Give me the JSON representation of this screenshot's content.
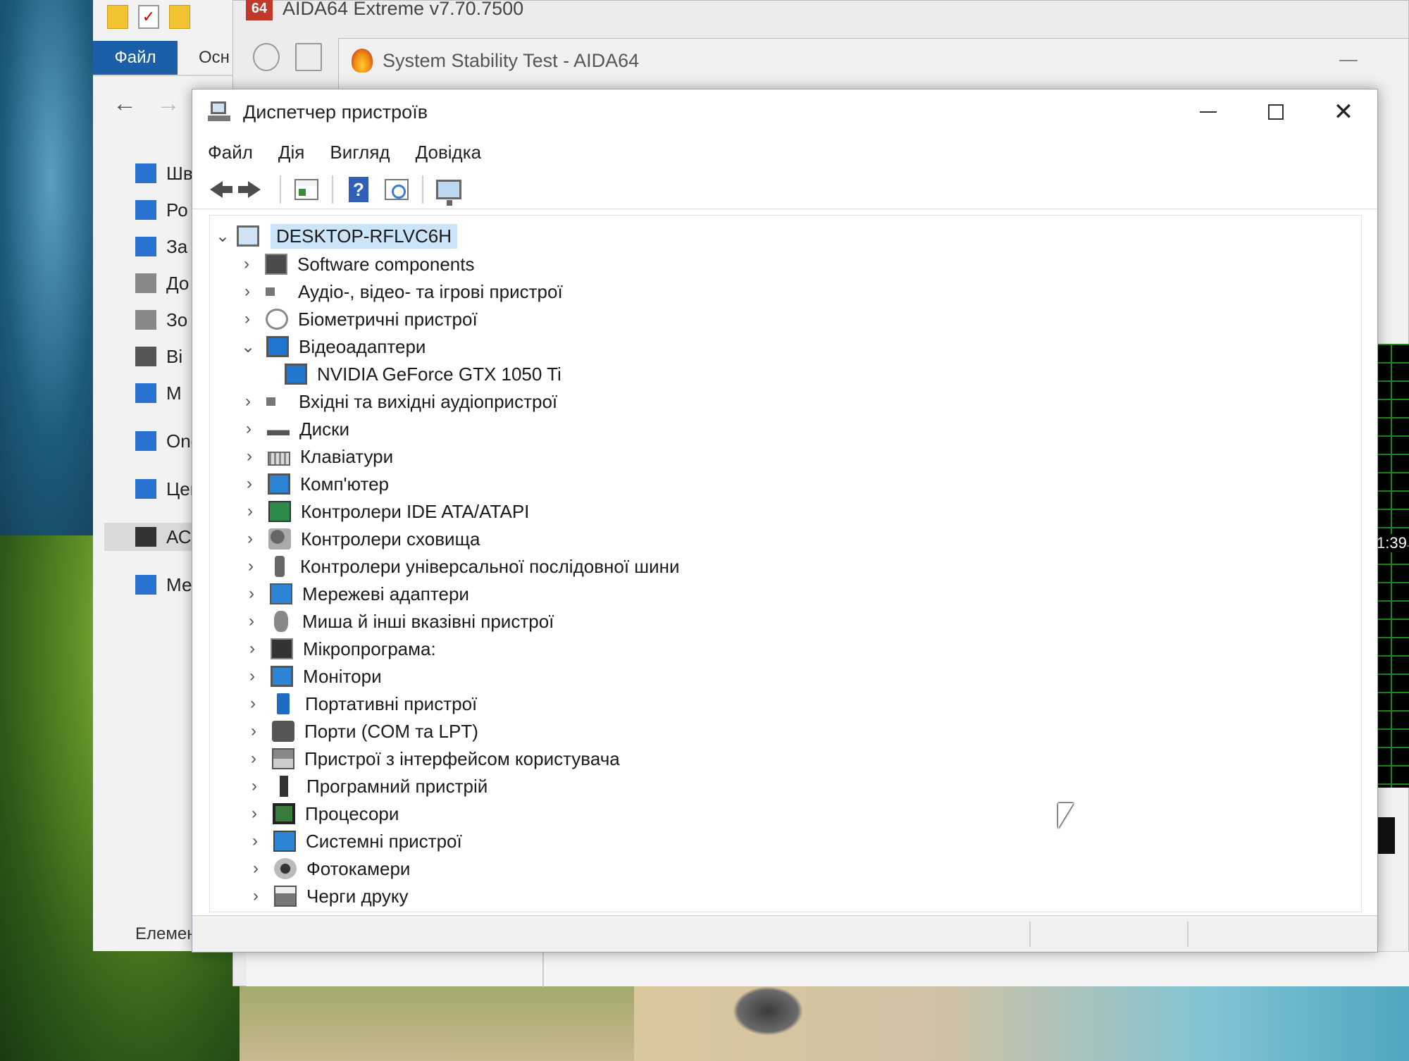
{
  "explorer": {
    "ribbon_file": "Файл",
    "ribbon_tab": "Осн",
    "nav_items": [
      {
        "label": "Шв",
        "icon": "star-icon"
      },
      {
        "label": "Ро",
        "icon": "desktop-icon"
      },
      {
        "label": "За",
        "icon": "download-icon"
      },
      {
        "label": "До",
        "icon": "document-icon"
      },
      {
        "label": "Зо",
        "icon": "picture-icon"
      },
      {
        "label": "Ві",
        "icon": "video-icon"
      },
      {
        "label": "М",
        "icon": "music-icon"
      },
      {
        "label": "One",
        "icon": "cloud-icon"
      },
      {
        "label": "Цей",
        "icon": "computer-icon"
      },
      {
        "label": "АСЕ",
        "icon": "drive-icon"
      },
      {
        "label": "Ме",
        "icon": "network-icon"
      }
    ],
    "status": "Елементі"
  },
  "aida": {
    "main_title": "AIDA64 Extreme v7.70.7500",
    "logo_text": "64",
    "sst_title": "System Stability Test - AIDA64",
    "graph_time": "1:39"
  },
  "devmgr": {
    "title": "Диспетчер пристроїв",
    "menu": [
      "Файл",
      "Дія",
      "Вигляд",
      "Довідка"
    ],
    "help_glyph": "?",
    "root": "DESKTOP-RFLVC6H",
    "categories": [
      {
        "label": "Software components",
        "icon": "software-component-icon",
        "expanded": false
      },
      {
        "label": "Аудіо-, відео- та ігрові пристрої",
        "icon": "speaker-icon",
        "expanded": false
      },
      {
        "label": "Біометричні пристрої",
        "icon": "fingerprint-icon",
        "expanded": false
      },
      {
        "label": "Відеоадаптери",
        "icon": "display-adapter-icon",
        "expanded": true,
        "children": [
          "NVIDIA GeForce GTX 1050 Ti"
        ]
      },
      {
        "label": "Вхідні та вихідні аудіопристрої",
        "icon": "speaker-icon",
        "expanded": false
      },
      {
        "label": "Диски",
        "icon": "disk-drive-icon",
        "expanded": false
      },
      {
        "label": "Клавіатури",
        "icon": "keyboard-icon",
        "expanded": false
      },
      {
        "label": "Комп'ютер",
        "icon": "computer-icon",
        "expanded": false
      },
      {
        "label": "Контролери IDE ATA/ATAPI",
        "icon": "ide-controller-icon",
        "expanded": false
      },
      {
        "label": "Контролери сховища",
        "icon": "storage-controller-icon",
        "expanded": false
      },
      {
        "label": "Контролери універсальної послідовної шини",
        "icon": "usb-icon",
        "expanded": false
      },
      {
        "label": "Мережеві адаптери",
        "icon": "network-adapter-icon",
        "expanded": false
      },
      {
        "label": "Миша й інші вказівні пристрої",
        "icon": "mouse-icon",
        "expanded": false
      },
      {
        "label": "Мікропрограма:",
        "icon": "firmware-icon",
        "expanded": false
      },
      {
        "label": "Монітори",
        "icon": "monitor-icon",
        "expanded": false
      },
      {
        "label": "Портативні пристрої",
        "icon": "portable-device-icon",
        "expanded": false
      },
      {
        "label": "Порти (COM та LPT)",
        "icon": "port-icon",
        "expanded": false
      },
      {
        "label": "Пристрої з інтерфейсом користувача",
        "icon": "hid-icon",
        "expanded": false
      },
      {
        "label": "Програмний пристрій",
        "icon": "software-device-icon",
        "expanded": false
      },
      {
        "label": "Процесори",
        "icon": "cpu-icon",
        "expanded": false
      },
      {
        "label": "Системні пристрої",
        "icon": "system-device-icon",
        "expanded": false
      },
      {
        "label": "Фотокамери",
        "icon": "camera-icon",
        "expanded": false
      },
      {
        "label": "Черги друку",
        "icon": "printer-icon",
        "expanded": false
      }
    ]
  },
  "colors": {
    "selection": "#cce4f7",
    "ribbon_file": "#1b5fa8",
    "aida_logo": "#c0392b"
  }
}
